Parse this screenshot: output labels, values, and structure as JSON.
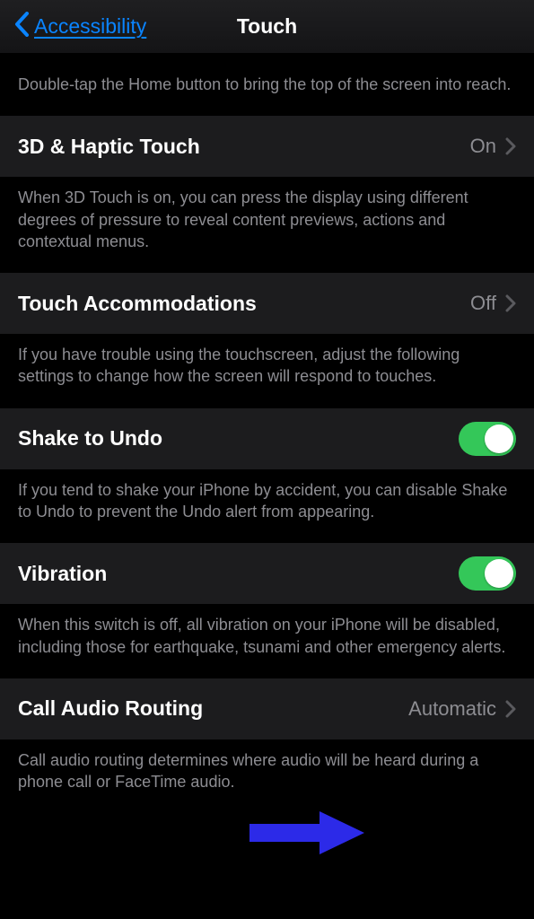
{
  "nav": {
    "back_label": "Accessibility",
    "title": "Touch"
  },
  "footers": {
    "reachability": "Double-tap the Home button to bring the top of the screen into reach.",
    "haptic3d": "When 3D Touch is on, you can press the display using different degrees of pressure to reveal content previews, actions and contextual menus.",
    "touch_accom": "If you have trouble using the touchscreen, adjust the following settings to change how the screen will respond to touches.",
    "shake": "If you tend to shake your iPhone by accident, you can disable Shake to Undo to prevent the Undo alert from appearing.",
    "vibration": "When this switch is off, all vibration on your iPhone will be disabled, including those for earthquake, tsunami and other emergency alerts.",
    "call_audio": "Call audio routing determines where audio will be heard during a phone call or FaceTime audio."
  },
  "rows": {
    "haptic3d": {
      "label": "3D & Haptic Touch",
      "value": "On"
    },
    "touch_accom": {
      "label": "Touch Accommodations",
      "value": "Off"
    },
    "shake": {
      "label": "Shake to Undo"
    },
    "vibration": {
      "label": "Vibration"
    },
    "call_audio": {
      "label": "Call Audio Routing",
      "value": "Automatic"
    }
  },
  "colors": {
    "accent_blue": "#0a84ff",
    "toggle_green": "#34c759",
    "arrow_blue": "#2c2ae8"
  }
}
